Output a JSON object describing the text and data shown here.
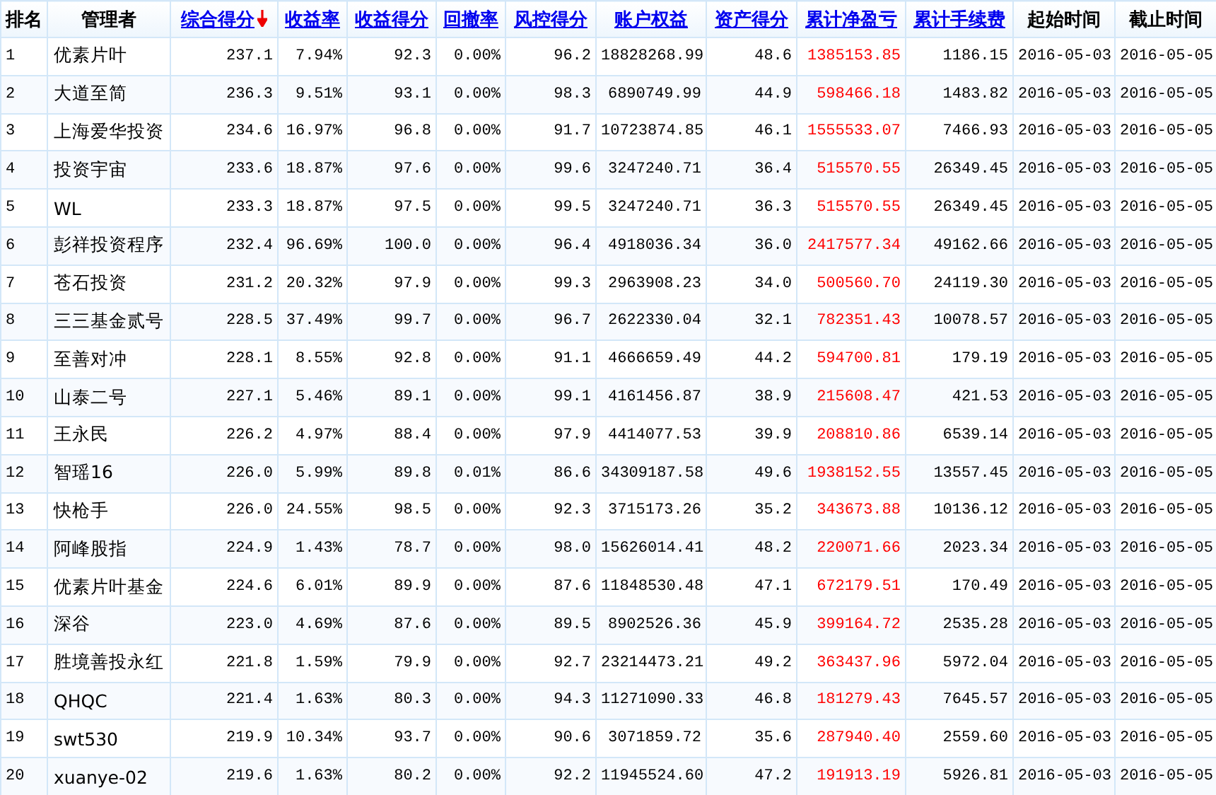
{
  "table": {
    "columns": [
      {
        "label": "排名",
        "kind": "plain",
        "sorted": false,
        "emphasis": false
      },
      {
        "label": "管理者",
        "kind": "plain",
        "sorted": false,
        "emphasis": false
      },
      {
        "label": "综合得分",
        "kind": "link",
        "sorted": true,
        "emphasis": false
      },
      {
        "label": "收益率",
        "kind": "link",
        "sorted": false,
        "emphasis": false
      },
      {
        "label": "收益得分",
        "kind": "link",
        "sorted": false,
        "emphasis": false
      },
      {
        "label": "回撤率",
        "kind": "link",
        "sorted": false,
        "emphasis": false
      },
      {
        "label": "风控得分",
        "kind": "link",
        "sorted": false,
        "emphasis": false
      },
      {
        "label": "账户权益",
        "kind": "link",
        "sorted": false,
        "emphasis": false
      },
      {
        "label": "资产得分",
        "kind": "link",
        "sorted": false,
        "emphasis": false
      },
      {
        "label": "累计净盈亏",
        "kind": "link",
        "sorted": false,
        "emphasis": true
      },
      {
        "label": "累计手续费",
        "kind": "link",
        "sorted": false,
        "emphasis": false
      },
      {
        "label": "起始时间",
        "kind": "plain",
        "sorted": false,
        "emphasis": false
      },
      {
        "label": "截止时间",
        "kind": "plain",
        "sorted": false,
        "emphasis": false
      }
    ],
    "rows": [
      [
        "1",
        "优素片叶",
        "237.1",
        "7.94%",
        "92.3",
        "0.00%",
        "96.2",
        "18828268.99",
        "48.6",
        "1385153.85",
        "1186.15",
        "2016-05-03",
        "2016-05-05"
      ],
      [
        "2",
        "大道至简",
        "236.3",
        "9.51%",
        "93.1",
        "0.00%",
        "98.3",
        "6890749.99",
        "44.9",
        "598466.18",
        "1483.82",
        "2016-05-03",
        "2016-05-05"
      ],
      [
        "3",
        "上海爱华投资",
        "234.6",
        "16.97%",
        "96.8",
        "0.00%",
        "91.7",
        "10723874.85",
        "46.1",
        "1555533.07",
        "7466.93",
        "2016-05-03",
        "2016-05-05"
      ],
      [
        "4",
        "投资宇宙",
        "233.6",
        "18.87%",
        "97.6",
        "0.00%",
        "99.6",
        "3247240.71",
        "36.4",
        "515570.55",
        "26349.45",
        "2016-05-03",
        "2016-05-05"
      ],
      [
        "5",
        "WL",
        "233.3",
        "18.87%",
        "97.5",
        "0.00%",
        "99.5",
        "3247240.71",
        "36.3",
        "515570.55",
        "26349.45",
        "2016-05-03",
        "2016-05-05"
      ],
      [
        "6",
        "彭祥投资程序",
        "232.4",
        "96.69%",
        "100.0",
        "0.00%",
        "96.4",
        "4918036.34",
        "36.0",
        "2417577.34",
        "49162.66",
        "2016-05-03",
        "2016-05-05"
      ],
      [
        "7",
        "苍石投资",
        "231.2",
        "20.32%",
        "97.9",
        "0.00%",
        "99.3",
        "2963908.23",
        "34.0",
        "500560.70",
        "24119.30",
        "2016-05-03",
        "2016-05-05"
      ],
      [
        "8",
        "三三基金贰号",
        "228.5",
        "37.49%",
        "99.7",
        "0.00%",
        "96.7",
        "2622330.04",
        "32.1",
        "782351.43",
        "10078.57",
        "2016-05-03",
        "2016-05-05"
      ],
      [
        "9",
        "至善对冲",
        "228.1",
        "8.55%",
        "92.8",
        "0.00%",
        "91.1",
        "4666659.49",
        "44.2",
        "594700.81",
        "179.19",
        "2016-05-03",
        "2016-05-05"
      ],
      [
        "10",
        "山泰二号",
        "227.1",
        "5.46%",
        "89.1",
        "0.00%",
        "99.1",
        "4161456.87",
        "38.9",
        "215608.47",
        "421.53",
        "2016-05-03",
        "2016-05-05"
      ],
      [
        "11",
        "王永民",
        "226.2",
        "4.97%",
        "88.4",
        "0.00%",
        "97.9",
        "4414077.53",
        "39.9",
        "208810.86",
        "6539.14",
        "2016-05-03",
        "2016-05-05"
      ],
      [
        "12",
        "智瑶16",
        "226.0",
        "5.99%",
        "89.8",
        "0.01%",
        "86.6",
        "34309187.58",
        "49.6",
        "1938152.55",
        "13557.45",
        "2016-05-03",
        "2016-05-05"
      ],
      [
        "13",
        "快枪手",
        "226.0",
        "24.55%",
        "98.5",
        "0.00%",
        "92.3",
        "3715173.26",
        "35.2",
        "343673.88",
        "10136.12",
        "2016-05-03",
        "2016-05-05"
      ],
      [
        "14",
        "阿峰股指",
        "224.9",
        "1.43%",
        "78.7",
        "0.00%",
        "98.0",
        "15626014.41",
        "48.2",
        "220071.66",
        "2023.34",
        "2016-05-03",
        "2016-05-05"
      ],
      [
        "15",
        "优素片叶基金",
        "224.6",
        "6.01%",
        "89.9",
        "0.00%",
        "87.6",
        "11848530.48",
        "47.1",
        "672179.51",
        "170.49",
        "2016-05-03",
        "2016-05-05"
      ],
      [
        "16",
        "深谷",
        "223.0",
        "4.69%",
        "87.6",
        "0.00%",
        "89.5",
        "8902526.36",
        "45.9",
        "399164.72",
        "2535.28",
        "2016-05-03",
        "2016-05-05"
      ],
      [
        "17",
        "胜境善投永红",
        "221.8",
        "1.59%",
        "79.9",
        "0.00%",
        "92.7",
        "23214473.21",
        "49.2",
        "363437.96",
        "5972.04",
        "2016-05-03",
        "2016-05-05"
      ],
      [
        "18",
        "QHQC",
        "221.4",
        "1.63%",
        "80.3",
        "0.00%",
        "94.3",
        "11271090.33",
        "46.8",
        "181279.43",
        "7645.57",
        "2016-05-03",
        "2016-05-05"
      ],
      [
        "19",
        "swt530",
        "219.9",
        "10.34%",
        "93.7",
        "0.00%",
        "90.6",
        "3071859.72",
        "35.6",
        "287940.40",
        "2559.60",
        "2016-05-03",
        "2016-05-05"
      ],
      [
        "20",
        "xuanye-02",
        "219.6",
        "1.63%",
        "80.2",
        "0.00%",
        "92.2",
        "11945524.60",
        "47.2",
        "191913.19",
        "5926.81",
        "2016-05-03",
        "2016-05-05"
      ]
    ]
  }
}
